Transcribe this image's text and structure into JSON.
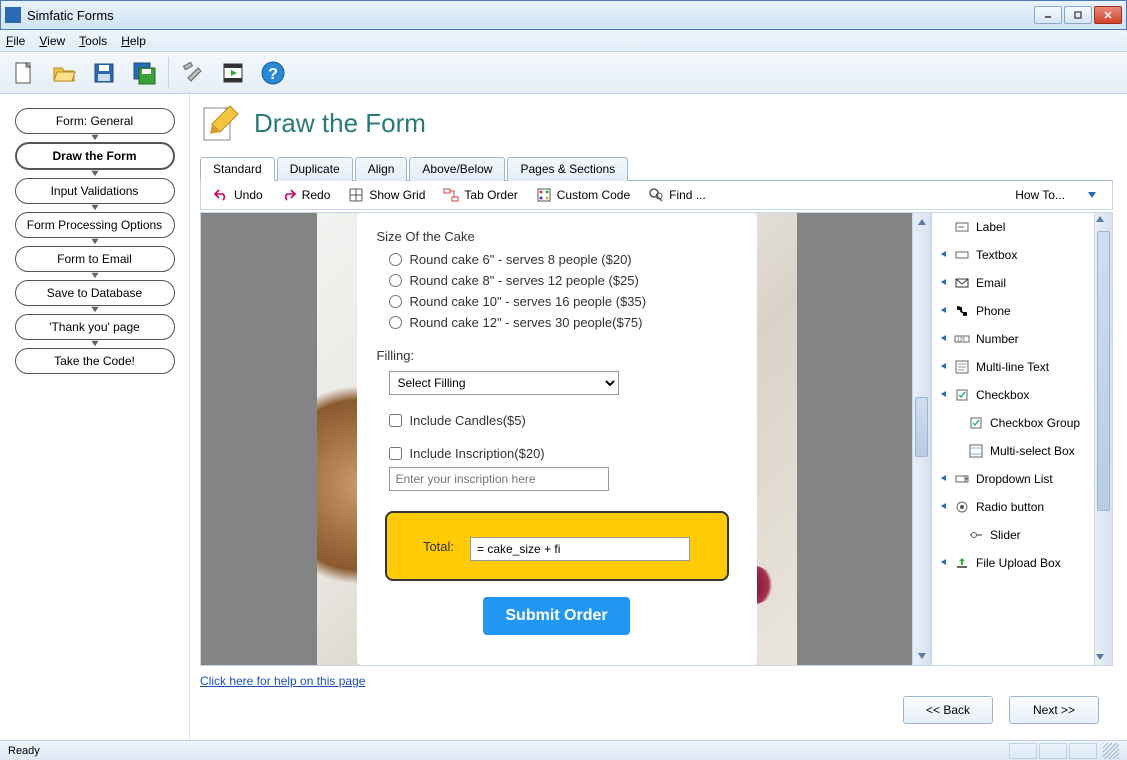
{
  "window": {
    "title": "Simfatic Forms"
  },
  "menu": {
    "file": "File",
    "view": "View",
    "tools": "Tools",
    "help": "Help"
  },
  "steps": [
    {
      "label": "Form: General",
      "active": false
    },
    {
      "label": "Draw the Form",
      "active": true
    },
    {
      "label": "Input Validations",
      "active": false
    },
    {
      "label": "Form Processing Options",
      "active": false
    },
    {
      "label": "Form to Email",
      "active": false
    },
    {
      "label": "Save to Database",
      "active": false
    },
    {
      "label": "'Thank you' page",
      "active": false
    },
    {
      "label": "Take the Code!",
      "active": false
    }
  ],
  "page": {
    "title": "Draw the Form"
  },
  "tabs": [
    {
      "label": "Standard",
      "active": true
    },
    {
      "label": "Duplicate",
      "active": false
    },
    {
      "label": "Align",
      "active": false
    },
    {
      "label": "Above/Below",
      "active": false
    },
    {
      "label": "Pages & Sections",
      "active": false
    }
  ],
  "subtb": {
    "undo": "Undo",
    "redo": "Redo",
    "showgrid": "Show Grid",
    "taborder": "Tab Order",
    "customcode": "Custom Code",
    "find": "Find ...",
    "howto": "How To..."
  },
  "form": {
    "size_label": "Size Of the Cake",
    "sizes": [
      "Round cake 6\" - serves 8 people ($20)",
      "Round cake 8\" - serves 12 people ($25)",
      "Round cake 10\" - serves 16 people ($35)",
      "Round cake 12\" - serves 30 people($75)"
    ],
    "filling_label": "Filling:",
    "filling_selected": "Select Filling",
    "candles": "Include Candles($5)",
    "inscription": "Include Inscription($20)",
    "inscription_placeholder": "Enter your inscription here",
    "total_label": "Total:",
    "total_value": "= cake_size + fi",
    "submit": "Submit Order"
  },
  "palette": [
    {
      "label": "Label",
      "caret": false,
      "icon": "label"
    },
    {
      "label": "Textbox",
      "caret": true,
      "icon": "textbox"
    },
    {
      "label": "Email",
      "caret": true,
      "icon": "email"
    },
    {
      "label": "Phone",
      "caret": true,
      "icon": "phone"
    },
    {
      "label": "Number",
      "caret": true,
      "icon": "number"
    },
    {
      "label": "Multi-line Text",
      "caret": true,
      "icon": "multiline"
    },
    {
      "label": "Checkbox",
      "caret": true,
      "icon": "checkbox"
    },
    {
      "label": "Checkbox Group",
      "caret": false,
      "icon": "checkbox",
      "indent": true
    },
    {
      "label": "Multi-select Box",
      "caret": false,
      "icon": "multiselect",
      "indent": true
    },
    {
      "label": "Dropdown List",
      "caret": true,
      "icon": "dropdown"
    },
    {
      "label": "Radio button",
      "caret": true,
      "icon": "radio"
    },
    {
      "label": "Slider",
      "caret": false,
      "icon": "slider",
      "indent": true
    },
    {
      "label": "File Upload Box",
      "caret": true,
      "icon": "upload"
    }
  ],
  "helplink": "Click here for help on this page",
  "nav": {
    "back": "<< Back",
    "next": "Next >>"
  },
  "status": {
    "ready": "Ready"
  }
}
